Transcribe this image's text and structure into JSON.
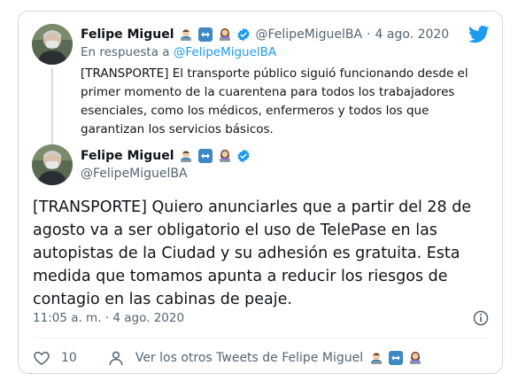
{
  "parent": {
    "name": "Felipe Miguel",
    "handle": "@FelipeMiguelBA",
    "separator": "·",
    "date": "4 ago. 2020",
    "reply_prefix": "En respuesta a",
    "reply_to": "@FelipeMiguelBA",
    "text": "[TRANSPORTE] El transporte público siguió funcionando desde el primer momento de la cuarentena para todos los trabajadores esenciales, como los médicos, enfermeros y todos los que garantizan los servicios básicos."
  },
  "main": {
    "name": "Felipe Miguel",
    "handle": "@FelipeMiguelBA",
    "text": "[TRANSPORTE] Quiero anunciarles que a partir del 28 de agosto va a ser obligatorio el uso de TelePase en las autopistas de la Ciudad y su adhesión es gratuita. Esta medida que tomamos apunta a reducir los riesgos de contagio en las cabinas de peaje.",
    "timestamp": "11:05 a. m. · 4 ago. 2020"
  },
  "footer": {
    "likes": "10",
    "more_tweets": "Ver los otros Tweets de Felipe Miguel"
  },
  "colors": {
    "accent": "#1d9bf0",
    "muted": "#536471",
    "border": "#cfd9de"
  }
}
